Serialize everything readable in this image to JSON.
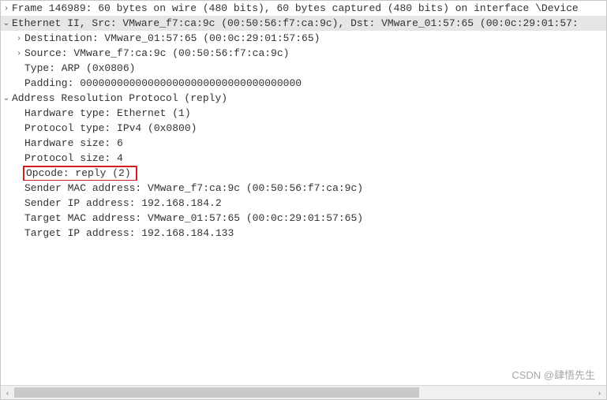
{
  "frame": {
    "summary": "Frame 146989: 60 bytes on wire (480 bits), 60 bytes captured (480 bits) on interface \\Device"
  },
  "ethernet": {
    "summary": "Ethernet II, Src: VMware_f7:ca:9c (00:50:56:f7:ca:9c), Dst: VMware_01:57:65 (00:0c:29:01:57:",
    "destination": "Destination: VMware_01:57:65 (00:0c:29:01:57:65)",
    "source": "Source: VMware_f7:ca:9c (00:50:56:f7:ca:9c)",
    "type": "Type: ARP (0x0806)",
    "padding": "Padding: 000000000000000000000000000000000000"
  },
  "arp": {
    "summary": "Address Resolution Protocol (reply)",
    "hardware_type": "Hardware type: Ethernet (1)",
    "protocol_type": "Protocol type: IPv4 (0x0800)",
    "hardware_size": "Hardware size: 6",
    "protocol_size": "Protocol size: 4",
    "opcode": "Opcode: reply (2)",
    "sender_mac": "Sender MAC address: VMware_f7:ca:9c (00:50:56:f7:ca:9c)",
    "sender_ip": "Sender IP address: 192.168.184.2",
    "target_mac": "Target MAC address: VMware_01:57:65 (00:0c:29:01:57:65)",
    "target_ip": "Target IP address: 192.168.184.133"
  },
  "watermark": "CSDN @肆悟先生",
  "toggles": {
    "collapsed": "›",
    "expanded": "⌄"
  }
}
